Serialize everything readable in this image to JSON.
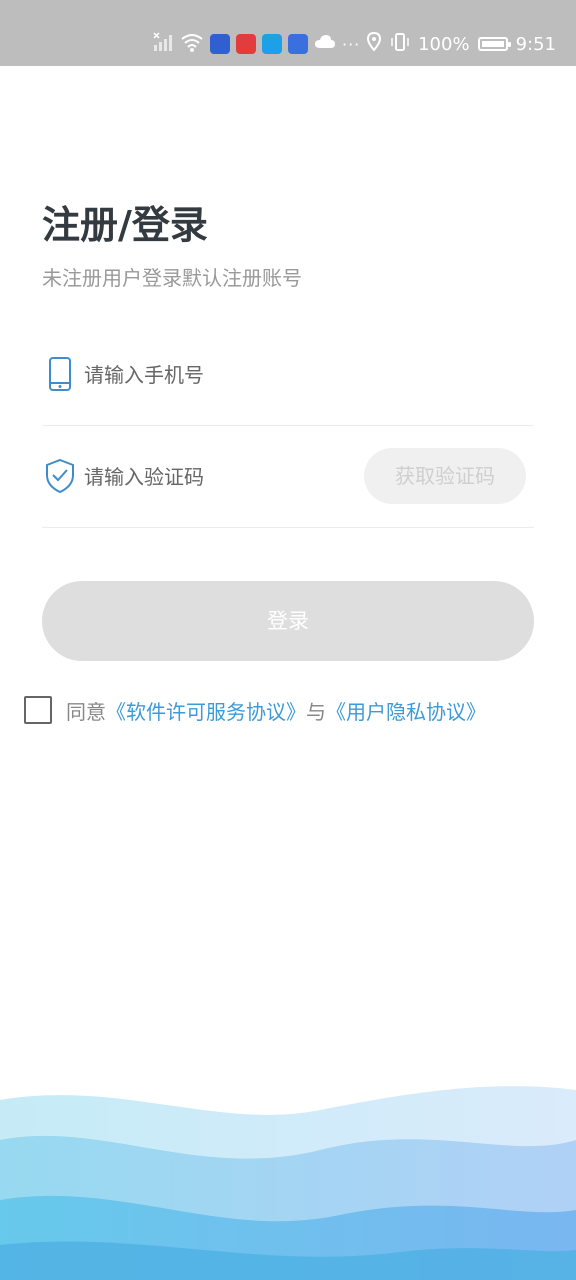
{
  "status_bar": {
    "battery_level": "100%",
    "time": "9:51",
    "notification_icons": [
      "baidu-app-icon",
      "red-app-icon",
      "eleme-app-icon",
      "taobao-app-icon",
      "cloud-icon"
    ],
    "overflow": "···"
  },
  "page": {
    "title": "注册/登录",
    "subtitle": "未注册用户登录默认注册账号"
  },
  "form": {
    "phone_placeholder": "请输入手机号",
    "code_placeholder": "请输入验证码",
    "get_code_label": "获取验证码",
    "login_label": "登录"
  },
  "agreement": {
    "checked": false,
    "prefix": "同意",
    "license_link": "《软件许可服务协议》",
    "joiner": "与",
    "privacy_link": "《用户隐私协议》"
  },
  "colors": {
    "status_bar_bg": "#bdbdbd",
    "link": "#3d9ad8",
    "icon": "#3f8ccc",
    "button_disabled": "#dedede"
  }
}
